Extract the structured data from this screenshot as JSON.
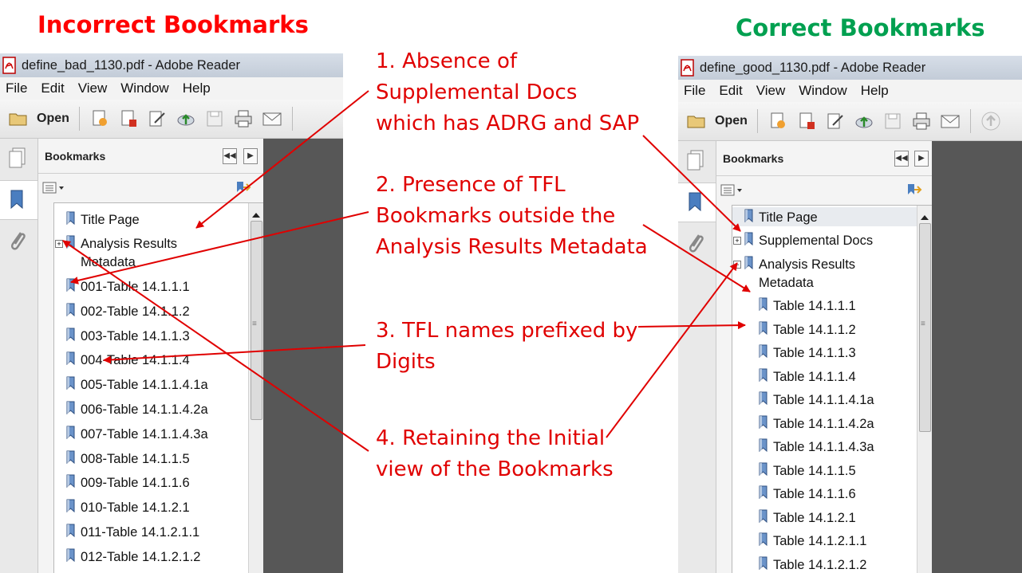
{
  "headings": {
    "incorrect": "Incorrect Bookmarks",
    "correct": "Correct Bookmarks"
  },
  "colors": {
    "incorrect_heading": "#ff0000",
    "correct_heading": "#00a050",
    "annotation": "#e00000",
    "arrow": "#e00000"
  },
  "annotations": [
    {
      "text": "1. Absence of\nSupplemental Docs\nwhich has ADRG and SAP"
    },
    {
      "text": "2. Presence of TFL\nBookmarks outside the\nAnalysis Results Metadata"
    },
    {
      "text": "3. TFL names prefixed by\nDigits"
    },
    {
      "text": "4. Retaining the Initial\nview of the Bookmarks"
    }
  ],
  "left_window": {
    "title": "define_bad_1130.pdf - Adobe Reader",
    "menu": [
      "File",
      "Edit",
      "View",
      "Window",
      "Help"
    ],
    "open_label": "Open",
    "panel_title": "Bookmarks",
    "bookmarks": [
      "Title Page",
      "Analysis Results\nMetadata",
      "001-Table 14.1.1.1",
      "002-Table 14.1.1.2",
      "003-Table 14.1.1.3",
      "004-Table 14.1.1.4",
      "005-Table 14.1.1.4.1a",
      "006-Table 14.1.1.4.2a",
      "007-Table 14.1.1.4.3a",
      "008-Table 14.1.1.5",
      "009-Table 14.1.1.6",
      "010-Table 14.1.2.1",
      "011-Table 14.1.2.1.1",
      "012-Table 14.1.2.1.2"
    ]
  },
  "right_window": {
    "title": "define_good_1130.pdf - Adobe Reader",
    "menu": [
      "File",
      "Edit",
      "View",
      "Window",
      "Help"
    ],
    "open_label": "Open",
    "panel_title": "Bookmarks",
    "bookmarks": [
      "Title Page",
      "Supplemental Docs",
      "Analysis Results\nMetadata",
      "Table 14.1.1.1",
      "Table 14.1.1.2",
      "Table 14.1.1.3",
      "Table 14.1.1.4",
      "Table 14.1.1.4.1a",
      "Table 14.1.1.4.2a",
      "Table 14.1.1.4.3a",
      "Table 14.1.1.5",
      "Table 14.1.1.6",
      "Table 14.1.2.1",
      "Table 14.1.2.1.1",
      "Table 14.1.2.1.2"
    ]
  }
}
